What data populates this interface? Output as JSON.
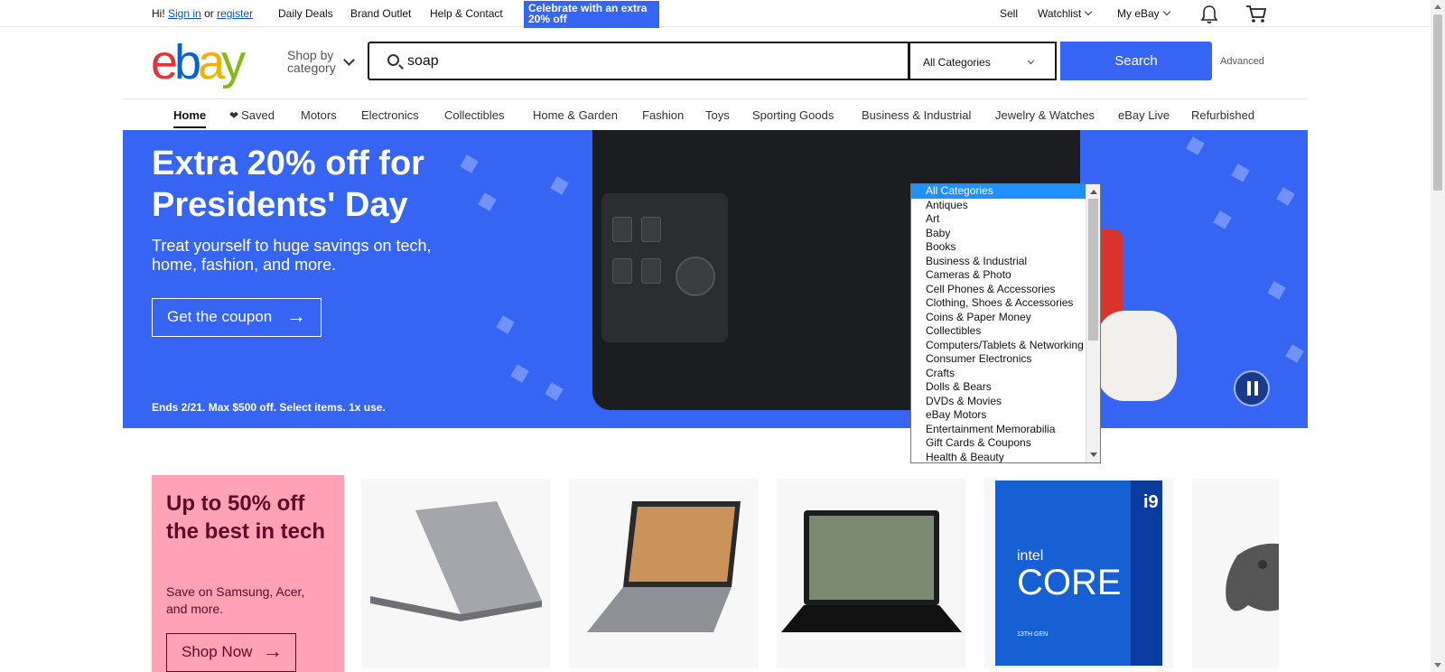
{
  "topbar": {
    "greeting": "Hi!",
    "sign_in": "Sign in",
    "or": "or",
    "register": "register",
    "links": [
      "Daily Deals",
      "Brand Outlet",
      "Help & Contact"
    ],
    "promo": "Celebrate with an extra 20% off",
    "sell": "Sell",
    "watchlist": "Watchlist",
    "my_ebay": "My eBay",
    "icons": [
      "bell-icon",
      "cart-icon"
    ]
  },
  "header": {
    "logo": {
      "e": "e",
      "b": "b",
      "a": "a",
      "y": "y"
    },
    "shop_by": "Shop by category",
    "search_value": "soap",
    "category_selected": "All Categories",
    "search_button": "Search",
    "advanced": "Advanced"
  },
  "nav": {
    "items": [
      "Home",
      "Saved",
      "Motors",
      "Electronics",
      "Collectibles",
      "Home & Garden",
      "Fashion",
      "Toys",
      "Sporting Goods",
      "Business & Industrial",
      "Jewelry & Watches",
      "eBay Live",
      "Refurbished"
    ],
    "active": "Home"
  },
  "hero": {
    "title": "Extra 20% off for Presidents' Day",
    "subtitle": "Treat yourself to huge savings on tech, home, fashion, and more.",
    "cta": "Get the coupon",
    "fine_print": "Ends 2/21. Max $500 off. Select items. 1x use.",
    "bg_color": "#3665f3"
  },
  "category_dropdown": {
    "options": [
      "All Categories",
      "Antiques",
      "Art",
      "Baby",
      "Books",
      "Business & Industrial",
      "Cameras & Photo",
      "Cell Phones & Accessories",
      "Clothing, Shoes & Accessories",
      "Coins & Paper Money",
      "Collectibles",
      "Computers/Tablets & Networking",
      "Consumer Electronics",
      "Crafts",
      "Dolls & Bears",
      "DVDs & Movies",
      "eBay Motors",
      "Entertainment Memorabilia",
      "Gift Cards & Coupons",
      "Health & Beauty"
    ],
    "selected": "All Categories"
  },
  "tech_promo": {
    "title": "Up to 50% off the best in tech",
    "subtitle": "Save on Samsung, Acer, and more.",
    "cta": "Shop Now",
    "bg_color": "#ffa2b6",
    "tiles": [
      {
        "product": "laptop"
      },
      {
        "product": "laptop"
      },
      {
        "product": "laptop"
      },
      {
        "product": "processor",
        "brand": "intel",
        "model_label": "CORE",
        "badge": "i9",
        "gen": "13TH GEN"
      },
      {
        "product": "game-controller"
      }
    ]
  }
}
